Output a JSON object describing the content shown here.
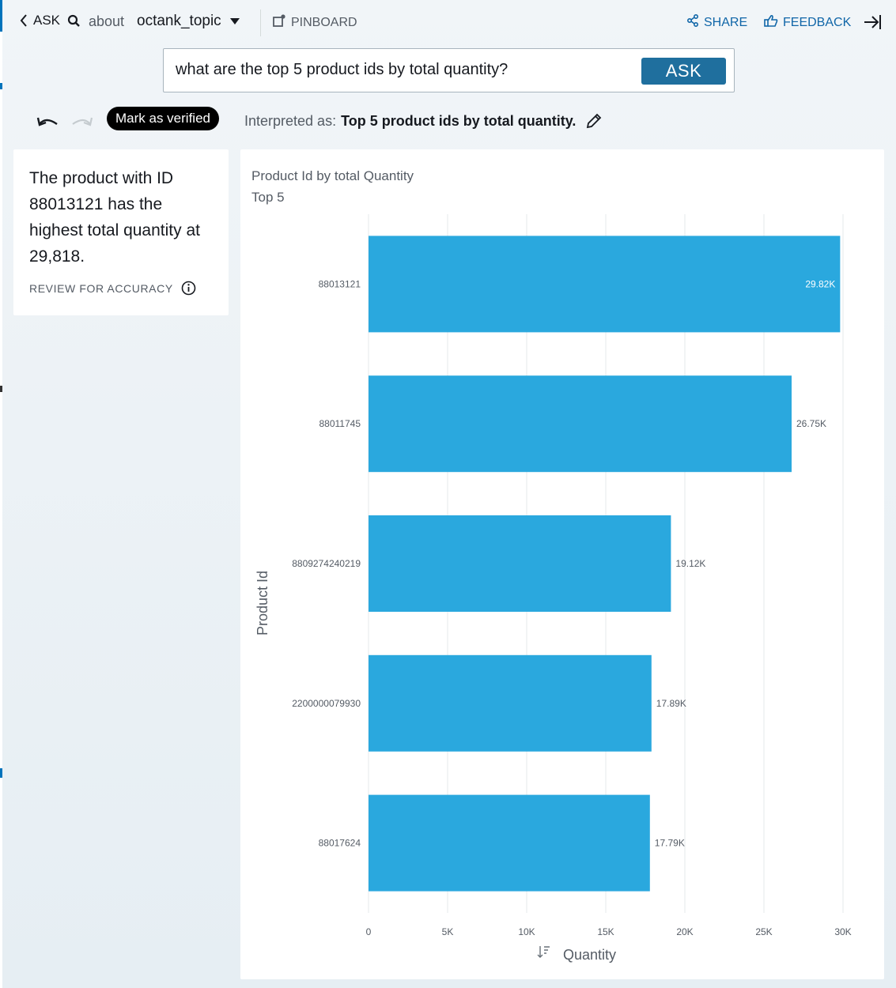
{
  "topbar": {
    "ask_label": "ASK",
    "about_label": "about",
    "topic_name": "octank_topic",
    "pinboard_label": "PINBOARD",
    "share_label": "SHARE",
    "feedback_label": "FEEDBACK"
  },
  "question": {
    "text": "what are the top 5 product ids by total quantity?",
    "ask_button": "ASK"
  },
  "interpretation": {
    "verified_label": "Mark as verified",
    "prefix": "Interpreted as:",
    "text": "Top 5 product ids by total quantity."
  },
  "narrative": {
    "text": "The product with ID 88013121 has the highest total quantity at 29,818.",
    "review_label": "REVIEW FOR ACCURACY"
  },
  "colors": {
    "bar": "#2aa8de",
    "accent": "#1066a8",
    "ask_button": "#1f6f9e"
  },
  "chart_data": {
    "type": "bar",
    "orientation": "horizontal",
    "title": "Product Id by total Quantity",
    "subtitle": "Top 5",
    "xlabel": "Quantity",
    "ylabel": "Product Id",
    "categories": [
      "88013121",
      "88011745",
      "8809274240219",
      "2200000079930",
      "88017624"
    ],
    "values": [
      29818,
      26750,
      19120,
      17890,
      17790
    ],
    "value_labels": [
      "29.82K",
      "26.75K",
      "19.12K",
      "17.89K",
      "17.79K"
    ],
    "xlim": [
      0,
      30000
    ],
    "xticks": [
      0,
      5000,
      10000,
      15000,
      20000,
      25000,
      30000
    ],
    "xtick_labels": [
      "0",
      "5K",
      "10K",
      "15K",
      "20K",
      "25K",
      "30K"
    ],
    "grid": true
  }
}
